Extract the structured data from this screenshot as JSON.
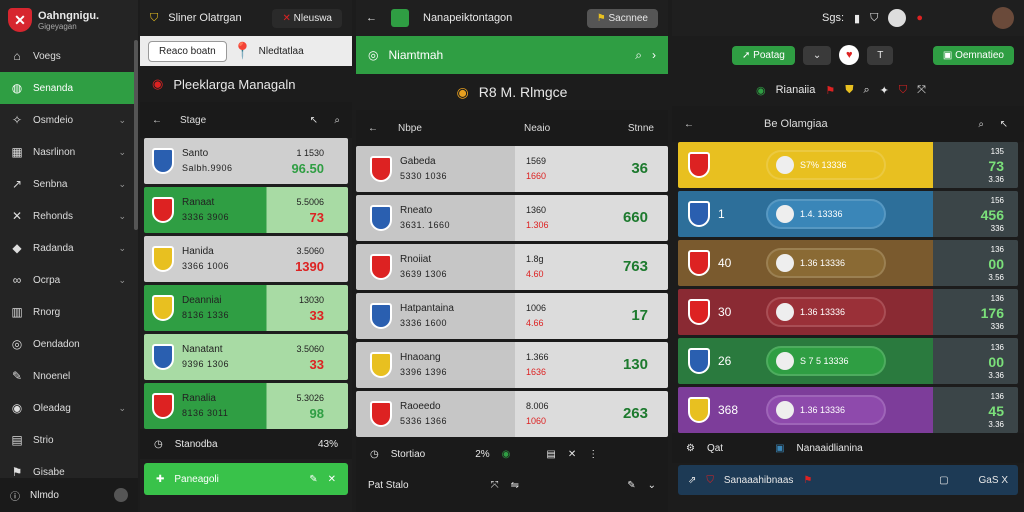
{
  "sidebar": {
    "title": "Oahngnigu.",
    "subtitle": "Gigeyagan",
    "items": [
      {
        "label": "Voegs",
        "icon": "home-icon"
      },
      {
        "label": "Senanda",
        "icon": "globe-icon",
        "active": true
      },
      {
        "label": "Osmdeio",
        "icon": "star-icon",
        "chev": true
      },
      {
        "label": "Nasrlinon",
        "icon": "grid-icon",
        "chev": true
      },
      {
        "label": "Senbna",
        "icon": "chart-icon",
        "chev": true
      },
      {
        "label": "Rehonds",
        "icon": "x-icon",
        "chev": true
      },
      {
        "label": "Radanda",
        "icon": "diamond-icon",
        "chev": true
      },
      {
        "label": "Ocrpa",
        "icon": "link-icon",
        "chev": true
      },
      {
        "label": "Rnorg",
        "icon": "bars-icon"
      },
      {
        "label": "Oendadon",
        "icon": "circle-icon"
      },
      {
        "label": "Nnoenel",
        "icon": "pin-icon"
      },
      {
        "label": "Oleadag",
        "icon": "ring-icon",
        "chev": true
      },
      {
        "label": "Strio",
        "icon": "table-icon"
      },
      {
        "label": "Gisabe",
        "icon": "flag-icon"
      }
    ],
    "bottom": "Nlmdo"
  },
  "p1": {
    "top_title": "Sliner Olatrgan",
    "search_text": "Nleuswa",
    "tab_a": "Reaco boatn",
    "tab_b": "Nledtatlaa",
    "title": "Pleeklarga Managaln",
    "col": "Stage",
    "footer": "Stanodba",
    "footer_val": "43%",
    "action": "Paneagoli",
    "rows": [
      {
        "name": "Santo",
        "sub": "Salbh.9906",
        "top": "1 1530",
        "big": "96.50",
        "bg": "#cfcfcf",
        "crest": "#2a5fb0",
        "valc": "#2f9e43"
      },
      {
        "name": "Ranaat",
        "sub": "3336 3906",
        "top": "5.5006",
        "big": "73",
        "bg": "#2f9e43",
        "bg2": "#a8dba4",
        "crest": "#d22",
        "valc": "#d22"
      },
      {
        "name": "Hanida",
        "sub": "3366 1006",
        "top": "3.5060",
        "big": "1390",
        "bg": "#cfcfcf",
        "crest": "#e8c020",
        "valc": "#d22"
      },
      {
        "name": "Deanniai",
        "sub": "8136 1336",
        "top": "13030",
        "big": "33",
        "bg": "#2f9e43",
        "bg2": "#a8dba4",
        "crest": "#e8c020",
        "valc": "#d22"
      },
      {
        "name": "Nanatant",
        "sub": "9396 1306",
        "top": "3.5060",
        "big": "33",
        "bg": "#a8dba4",
        "crest": "#2a5fb0",
        "valc": "#d22"
      },
      {
        "name": "Ranalia",
        "sub": "8136 3011",
        "top": "5.3026",
        "big": "98",
        "bg": "#2f9e43",
        "bg2": "#a8dba4",
        "crest": "#d22",
        "valc": "#2f9e43"
      }
    ]
  },
  "p2": {
    "top_title": "Nanapeiktontagon",
    "top_btn": "Sacnnee",
    "green_label": "Niamtmah",
    "title": "R8 M. Rlmgce",
    "col_a": "Nbpe",
    "col_b": "Neaio",
    "col_c": "Stnne",
    "footer": "Stortiao",
    "footer_val": "2%",
    "bottom": "Pat Stalo",
    "rows": [
      {
        "name": "Gabeda",
        "sub": "5330 1036",
        "mid": "1569",
        "mid2": "1660",
        "big": "36",
        "crest": "#d22"
      },
      {
        "name": "Rneato",
        "sub": "3631. 1660",
        "mid": "1360",
        "mid2": "1.306",
        "big": "660",
        "crest": "#2a5fb0"
      },
      {
        "name": "Rnoiiat",
        "sub": "3639 1306",
        "mid": "1.8g",
        "mid2": "4.60",
        "big": "763",
        "crest": "#d22"
      },
      {
        "name": "Hatpantaina",
        "sub": "3336 1600",
        "mid": "1006",
        "mid2": "4.66",
        "big": "17",
        "crest": "#2a5fb0"
      },
      {
        "name": "Hnaoang",
        "sub": "3396 1396",
        "mid": "1.366",
        "mid2": "1636",
        "big": "130",
        "crest": "#e8c020"
      },
      {
        "name": "Raoeedo",
        "sub": "5336 1366",
        "mid": "8.006",
        "mid2": "1060",
        "big": "263",
        "crest": "#d22"
      }
    ]
  },
  "p3": {
    "top_title": "Sgs:",
    "btn_a": "Poatag",
    "btn_b": "Oemnatieo",
    "tools": "Rianaiia",
    "title": "Be Olamgiaa",
    "footer_a": "Qat",
    "footer_b": "Nanaaidlianina",
    "bottom": "Sanaaahibnaas",
    "bottom_r": "GaS X",
    "rows": [
      {
        "num": "",
        "stat": "S7% 13336",
        "top": "135",
        "big": "73",
        "bot": "3.36",
        "color": "#e8c020",
        "bar": "#e8c020",
        "crest": "#d22"
      },
      {
        "num": "1",
        "stat": "1.4. 13336",
        "top": "156",
        "big": "456",
        "bot": "336",
        "color": "#2d6f9a",
        "bar": "#3a86b8",
        "crest": "#2a5fb0"
      },
      {
        "num": "40",
        "stat": "1.36 13336",
        "top": "136",
        "big": "00",
        "bot": "3.56",
        "color": "#7a5a2e",
        "bar": "#8a6a34",
        "crest": "#d22"
      },
      {
        "num": "30",
        "stat": "1.36 13336",
        "top": "136",
        "big": "176",
        "bot": "336",
        "color": "#8a2a33",
        "bar": "#9a3038",
        "crest": "#d22"
      },
      {
        "num": "26",
        "stat": "S 7 5 13336",
        "top": "136",
        "big": "00",
        "bot": "3.36",
        "color": "#2a7a3e",
        "bar": "#2f9e43",
        "crest": "#2a5fb0"
      },
      {
        "num": "368",
        "stat": "1.36 13336",
        "top": "136",
        "big": "45",
        "bot": "3.36",
        "color": "#7d3d9a",
        "bar": "#8e4aac",
        "crest": "#e8c020"
      }
    ]
  }
}
